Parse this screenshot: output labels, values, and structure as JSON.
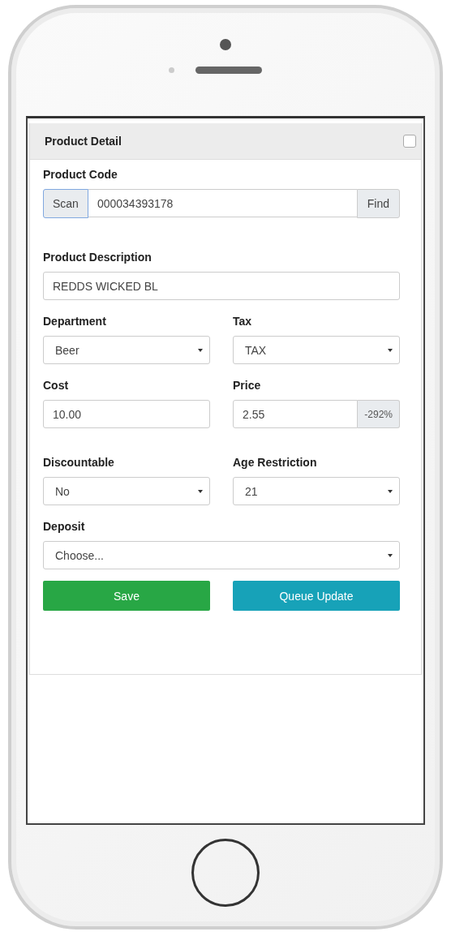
{
  "panel": {
    "title": "Product Detail",
    "checked": false
  },
  "product_code": {
    "label": "Product Code",
    "scan_button": "Scan",
    "value": "000034393178",
    "find_button": "Find"
  },
  "rows": [
    {
      "fields": [
        {
          "kind": "text",
          "label": "Product Description",
          "value": "REDDS WICKED BL"
        }
      ]
    },
    {
      "fields": [
        {
          "kind": "select",
          "label": "Department",
          "value": "Beer"
        },
        {
          "kind": "select",
          "label": "Tax",
          "value": "TAX"
        }
      ]
    },
    {
      "fields": [
        {
          "kind": "text",
          "label": "Cost",
          "value": "10.00"
        },
        {
          "kind": "addon",
          "label": "Price",
          "value": "2.55",
          "addon": "-292%"
        }
      ]
    },
    {
      "fields": [
        {
          "kind": "select",
          "label": "Discountable",
          "value": "No"
        },
        {
          "kind": "select",
          "label": "Age Restriction",
          "value": "21"
        }
      ]
    },
    {
      "fields": [
        {
          "kind": "select",
          "label": "Deposit",
          "value": "Choose..."
        }
      ]
    }
  ],
  "buttons": [
    {
      "label": "Save",
      "kind": "success"
    },
    {
      "label": "Queue Update",
      "kind": "info"
    }
  ]
}
